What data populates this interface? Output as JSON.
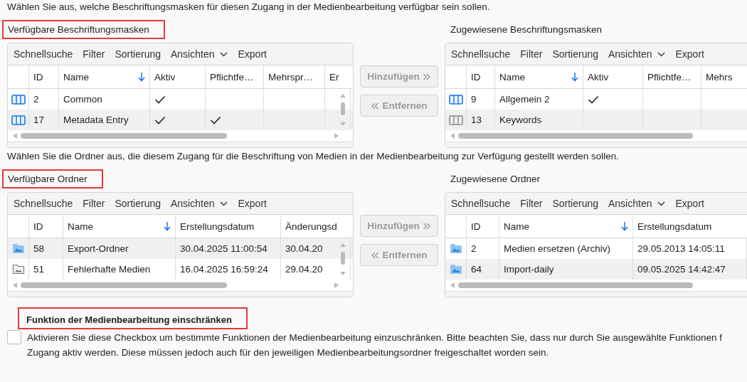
{
  "sections": [
    {
      "intro": "Wählen Sie aus, welche Beschriftungsmasken für diesen Zugang in der Medienbearbeitung verfügbar sein sollen.",
      "available": {
        "title": "Verfügbare Beschriftungsmasken",
        "highlighted": true,
        "toolbar": [
          "Schnellsuche",
          "Filter",
          "Sortierung",
          "Ansichten",
          "Export"
        ],
        "columns": [
          {
            "label": "ID",
            "kind": "text",
            "sorted": false
          },
          {
            "label": "Name",
            "kind": "text",
            "sorted": true
          },
          {
            "label": "Aktiv",
            "kind": "check",
            "sorted": false
          },
          {
            "label": "Pflichtfe…",
            "kind": "check",
            "sorted": false
          },
          {
            "label": "Mehrspr…",
            "kind": "check",
            "sorted": false
          },
          {
            "label": "Er",
            "kind": "check",
            "sorted": false
          }
        ],
        "rows": [
          {
            "active": true,
            "shaded": false,
            "cells": [
              "2",
              "Common",
              true,
              false,
              false,
              false
            ]
          },
          {
            "active": true,
            "shaded": true,
            "cells": [
              "17",
              "Metadata Entry",
              true,
              true,
              false,
              false
            ]
          }
        ]
      },
      "buttons": [
        {
          "label": "Hinzufügen",
          "kind": "add",
          "disabled": true
        },
        {
          "label": "Entfernen",
          "kind": "remove",
          "disabled": true
        }
      ],
      "assigned": {
        "title": "Zugewiesene Beschriftungsmasken",
        "highlighted": false,
        "toolbar": [
          "Schnellsuche",
          "Filter",
          "Sortierung",
          "Ansichten",
          "Export"
        ],
        "columns": [
          {
            "label": "ID",
            "kind": "text",
            "sorted": false
          },
          {
            "label": "Name",
            "kind": "text",
            "sorted": true
          },
          {
            "label": "Aktiv",
            "kind": "check",
            "sorted": false
          },
          {
            "label": "Pflichtfe…",
            "kind": "check",
            "sorted": false
          },
          {
            "label": "Mehrs",
            "kind": "check",
            "sorted": false
          }
        ],
        "rows": [
          {
            "active": true,
            "shaded": false,
            "cells": [
              "9",
              "Allgemein 2",
              true,
              false,
              false
            ]
          },
          {
            "active": false,
            "shaded": true,
            "cells": [
              "13",
              "Keywords",
              false,
              false,
              false
            ]
          }
        ]
      }
    },
    {
      "intro": "Wählen Sie die Ordner aus, die diesem Zugang für die Beschriftung von Medien in der Medienbearbeitung zur Verfügung gestellt werden sollen.",
      "available": {
        "title": "Verfügbare Ordner",
        "highlighted": true,
        "toolbar": [
          "Schnellsuche",
          "Filter",
          "Sortierung",
          "Ansichten",
          "Export"
        ],
        "columns": [
          {
            "label": "ID",
            "kind": "text",
            "sorted": false
          },
          {
            "label": "Name",
            "kind": "text",
            "sorted": true
          },
          {
            "label": "Erstellungsdatum",
            "kind": "text",
            "sorted": false
          },
          {
            "label": "Änderungsd",
            "kind": "text",
            "sorted": false
          }
        ],
        "rows": [
          {
            "active": true,
            "shaded": true,
            "cells": [
              "58",
              "Export-Ordner",
              "30.04.2025 11:00:54",
              "30.04.20"
            ]
          },
          {
            "active": false,
            "shaded": false,
            "cells": [
              "51",
              "Fehlerhafte Medien",
              "16.04.2025 16:59:24",
              "29.04.20"
            ]
          }
        ]
      },
      "buttons": [
        {
          "label": "Hinzufügen",
          "kind": "add",
          "disabled": true
        },
        {
          "label": "Entfernen",
          "kind": "remove",
          "disabled": true
        }
      ],
      "assigned": {
        "title": "Zugewiesene Ordner",
        "highlighted": false,
        "toolbar": [
          "Schnellsuche",
          "Filter",
          "Sortierung",
          "Ansichten",
          "Export"
        ],
        "columns": [
          {
            "label": "ID",
            "kind": "text",
            "sorted": false
          },
          {
            "label": "Name",
            "kind": "text",
            "sorted": true
          },
          {
            "label": "Erstellungsdatum",
            "kind": "text",
            "sorted": false
          }
        ],
        "rows": [
          {
            "active": true,
            "shaded": false,
            "cells": [
              "2",
              "Medien ersetzen (Archiv)",
              "29.05.2013 14:05:11"
            ]
          },
          {
            "active": true,
            "shaded": true,
            "cells": [
              "64",
              "Import-daily",
              "09.05.2025 14:42:47"
            ]
          }
        ]
      }
    }
  ],
  "restrict": {
    "title": "Funktion der Medienbearbeitung einschränken",
    "highlighted": true,
    "checked": false,
    "lines": [
      "Aktivieren Sie diese Checkbox um bestimmte Funktionen der Medienbearbeitung einzuschränken. Bitte beachten Sie, dass nur durch Sie ausgewählte Funktionen f",
      "Zugang aktiv werden. Diese müssen jedoch auch für den jeweiligen Medienbearbeitungsordner freigeschaltet worden sein."
    ]
  }
}
